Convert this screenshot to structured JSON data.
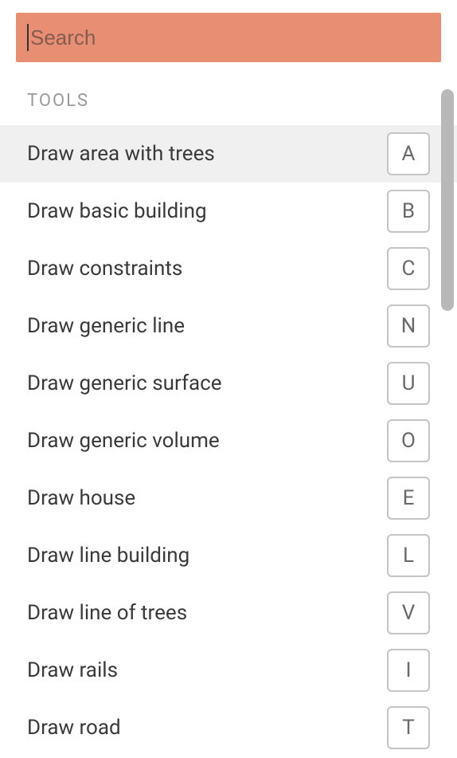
{
  "search": {
    "placeholder": "Search",
    "value": ""
  },
  "section_label": "TOOLS",
  "tools": [
    {
      "label": "Draw area with trees",
      "key": "A",
      "selected": true
    },
    {
      "label": "Draw basic building",
      "key": "B",
      "selected": false
    },
    {
      "label": "Draw constraints",
      "key": "C",
      "selected": false
    },
    {
      "label": "Draw generic line",
      "key": "N",
      "selected": false
    },
    {
      "label": "Draw generic surface",
      "key": "U",
      "selected": false
    },
    {
      "label": "Draw generic volume",
      "key": "O",
      "selected": false
    },
    {
      "label": "Draw house",
      "key": "E",
      "selected": false
    },
    {
      "label": "Draw line building",
      "key": "L",
      "selected": false
    },
    {
      "label": "Draw line of trees",
      "key": "V",
      "selected": false
    },
    {
      "label": "Draw rails",
      "key": "I",
      "selected": false
    },
    {
      "label": "Draw road",
      "key": "T",
      "selected": false
    }
  ],
  "colors": {
    "search_bg": "#e88f73",
    "selected_bg": "#f0f0f0",
    "text_primary": "#3a3a3a",
    "text_secondary": "#9a9a9a",
    "key_border": "#c4c4c4"
  }
}
